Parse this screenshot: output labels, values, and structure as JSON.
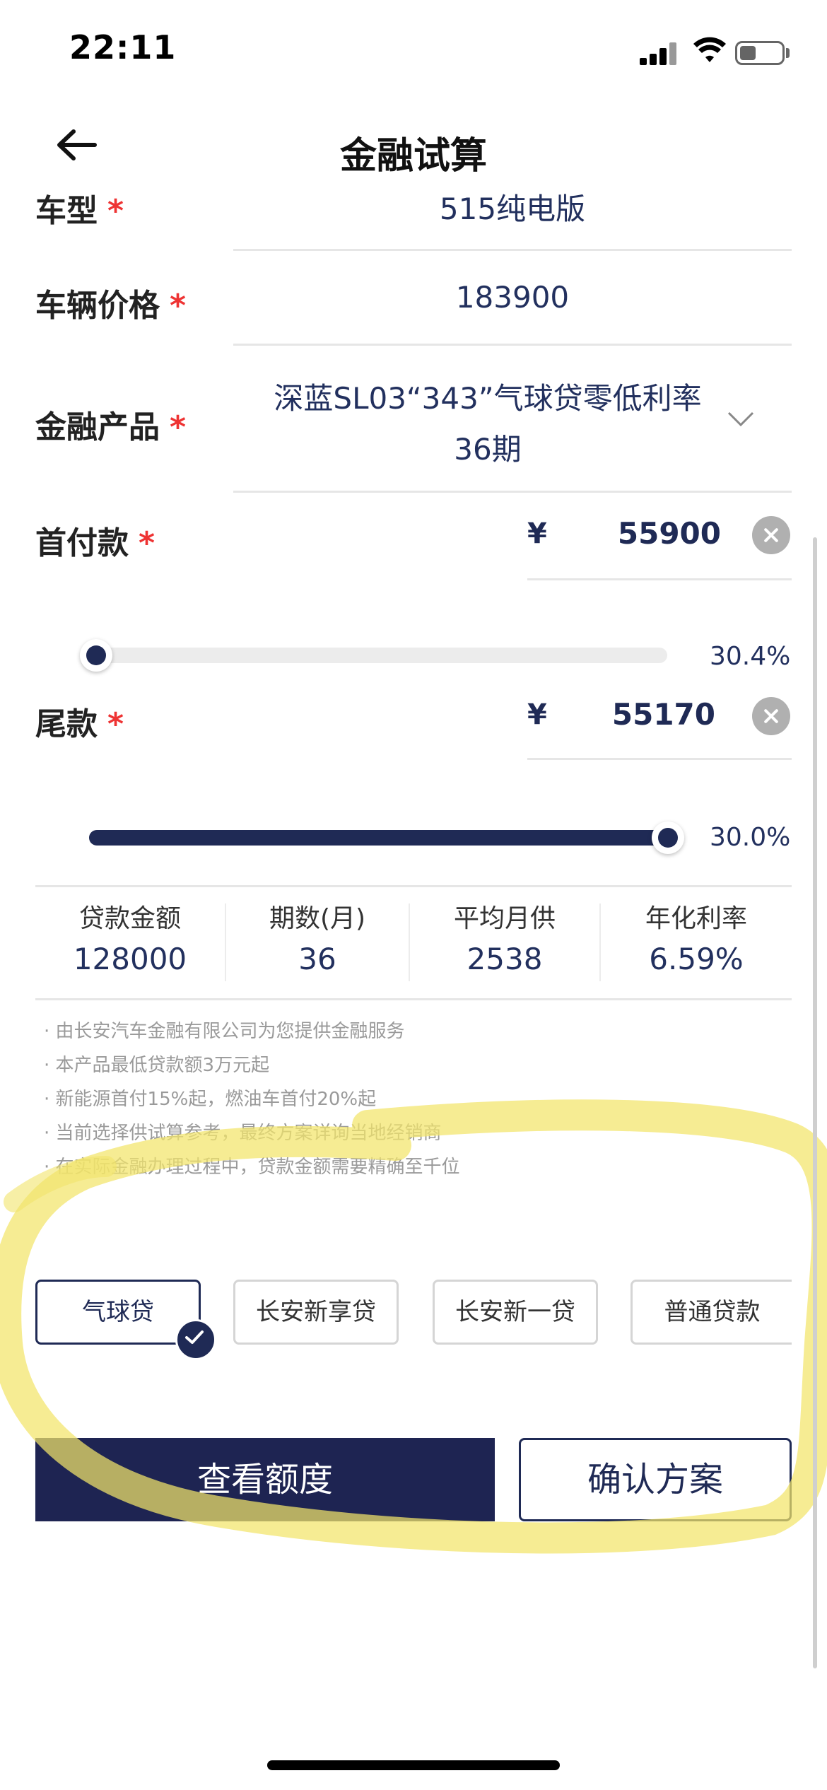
{
  "status_bar": {
    "time": "22:11"
  },
  "header": {
    "title": "金融试算"
  },
  "form": {
    "model": {
      "label": "车型",
      "required": "*",
      "value": "515纯电版"
    },
    "price": {
      "label": "车辆价格",
      "required": "*",
      "value": "183900"
    },
    "product": {
      "label": "金融产品",
      "required": "*",
      "value_line1": "深蓝SL03“343”气球贷零低利率",
      "value_line2": "36期"
    },
    "down_payment": {
      "label": "首付款",
      "required": "*",
      "currency": "¥",
      "amount": "55900",
      "percent": "30.4%",
      "slider_fraction": 0.0
    },
    "balloon": {
      "label": "尾款",
      "required": "*",
      "currency": "¥",
      "amount": "55170",
      "percent": "30.0%",
      "slider_fraction": 1.0
    }
  },
  "summary": [
    {
      "label": "贷款金额",
      "value": "128000"
    },
    {
      "label": "期数(月)",
      "value": "36"
    },
    {
      "label": "平均月供",
      "value": "2538"
    },
    {
      "label": "年化利率",
      "value": "6.59%"
    }
  ],
  "notes": [
    "· 由长安汽车金融有限公司为您提供金融服务",
    "· 本产品最低贷款额3万元起",
    "· 新能源首付15%起，燃油车首付20%起",
    "· 当前选择供试算参考，最终方案详询当地经销商",
    "· 在实际金融办理过程中，贷款金额需要精确至千位"
  ],
  "product_tabs": [
    {
      "label": "气球贷",
      "selected": true
    },
    {
      "label": "长安新享贷",
      "selected": false
    },
    {
      "label": "长安新一贷",
      "selected": false
    },
    {
      "label": "普通贷款",
      "selected": false
    }
  ],
  "actions": {
    "view_quota": "查看额度",
    "confirm_plan": "确认方案"
  },
  "colors": {
    "primary": "#1f2a55",
    "required": "#e33333",
    "highlight": "#f2e46a"
  }
}
